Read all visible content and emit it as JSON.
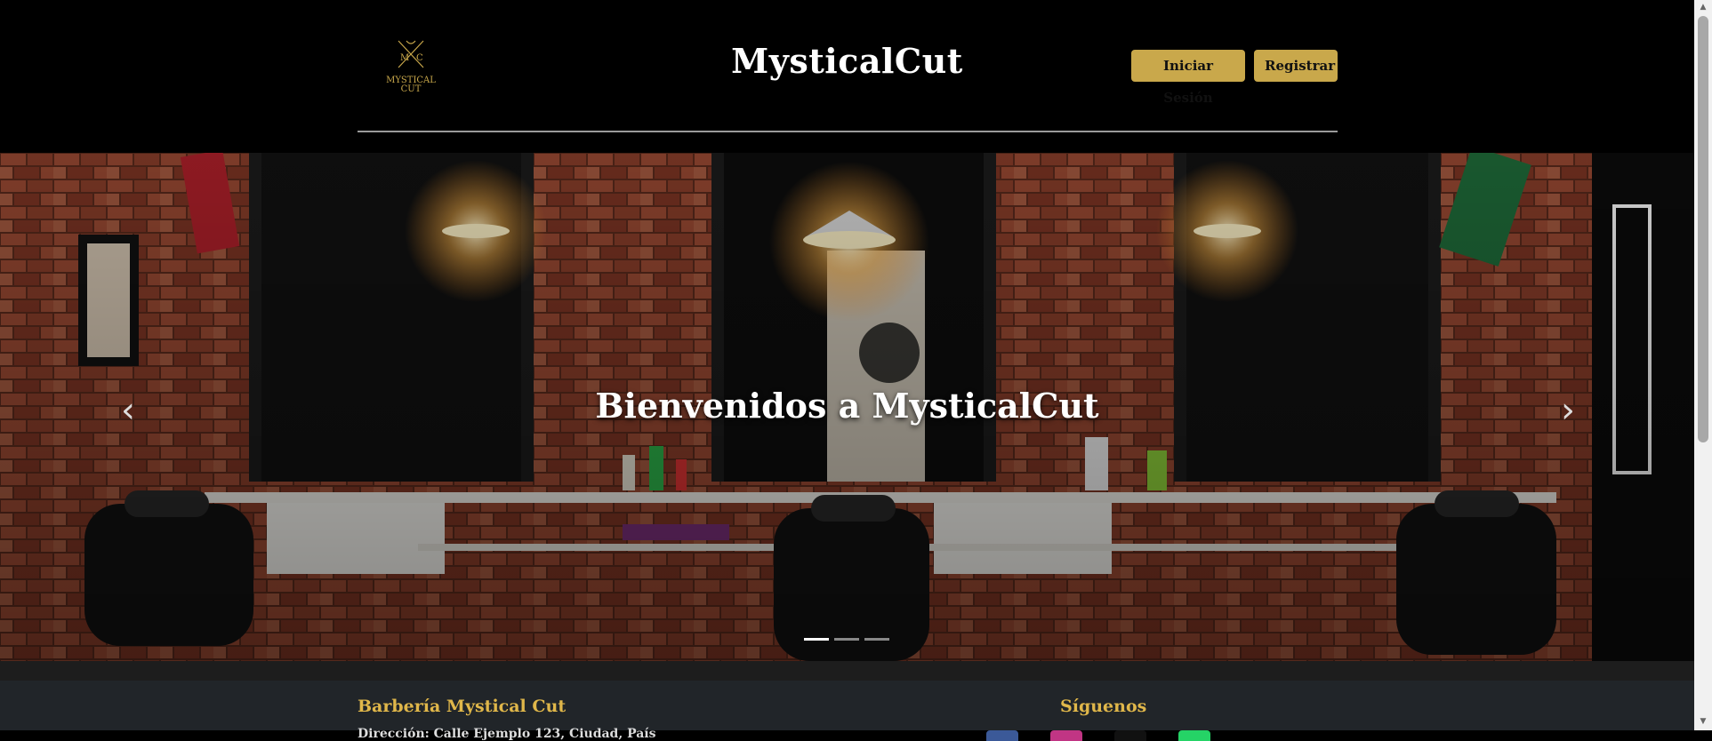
{
  "header": {
    "logo": {
      "initials_left": "M",
      "initials_right": "C",
      "line1": "MYSTICAL",
      "line2": "CUT"
    },
    "title": "MysticalCut",
    "login_label": "Iniciar Sesión",
    "register_label": "Registrar"
  },
  "hero": {
    "caption": "Bienvenidos a MysticalCut",
    "prev_icon": "chevron-left-icon",
    "next_icon": "chevron-right-icon",
    "prev_glyph": "‹",
    "next_glyph": "›",
    "slides_count": 3,
    "active_slide": 1
  },
  "footer": {
    "business_title": "Barbería Mystical Cut",
    "address_partial": "Dirección: Calle Ejemplo 123, Ciudad, País",
    "follow_title": "Síguenos",
    "socials": [
      "facebook-icon",
      "instagram-icon",
      "tiktok-icon",
      "whatsapp-icon"
    ]
  },
  "colors": {
    "accent": "#c9a84b",
    "footer_title": "#e0b74a",
    "footer_bg": "#212529",
    "header_bg": "#000000",
    "social_facebook": "#3b5998",
    "social_instagram": "#c13584",
    "social_tiktok": "#111111",
    "social_whatsapp": "#25d366"
  }
}
